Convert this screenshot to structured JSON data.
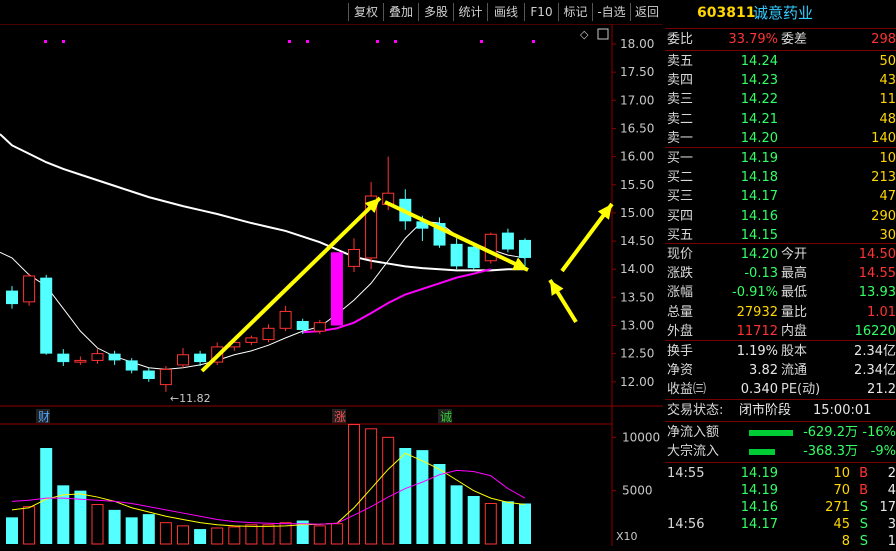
{
  "toolbar": {
    "buttons": [
      "复权",
      "叠加",
      "多股",
      "统计",
      "画线",
      "F10",
      "标记",
      "-自选",
      "返回"
    ]
  },
  "price_axis": {
    "ticks": [
      "18.00",
      "17.50",
      "17.00",
      "16.50",
      "16.00",
      "15.50",
      "15.00",
      "14.50",
      "14.00",
      "13.50",
      "13.00",
      "12.50",
      "12.00"
    ]
  },
  "volume_axis": {
    "ticks": [
      "10000",
      "5000"
    ],
    "unit": "X10"
  },
  "chart_labels": {
    "low_marker": "←11.82",
    "marker_cai": "财",
    "marker_zhang": "涨",
    "marker_cheng": "诚",
    "diamond": "◇"
  },
  "chart_data": {
    "type": "candlestick",
    "price_range": [
      11.7,
      18.1
    ],
    "candles": [
      {
        "o": 13.62,
        "c": 13.38,
        "h": 13.7,
        "l": 13.3
      },
      {
        "o": 13.42,
        "c": 13.88,
        "h": 13.92,
        "l": 13.35
      },
      {
        "o": 13.85,
        "c": 12.5,
        "h": 13.9,
        "l": 12.48
      },
      {
        "o": 12.5,
        "c": 12.35,
        "h": 12.58,
        "l": 12.28
      },
      {
        "o": 12.35,
        "c": 12.38,
        "h": 12.45,
        "l": 12.3
      },
      {
        "o": 12.38,
        "c": 12.5,
        "h": 12.58,
        "l": 12.32
      },
      {
        "o": 12.5,
        "c": 12.38,
        "h": 12.55,
        "l": 12.3
      },
      {
        "o": 12.38,
        "c": 12.2,
        "h": 12.42,
        "l": 12.15
      },
      {
        "o": 12.2,
        "c": 12.05,
        "h": 12.25,
        "l": 12.0
      },
      {
        "o": 11.95,
        "c": 12.22,
        "h": 12.28,
        "l": 11.82
      },
      {
        "o": 12.3,
        "c": 12.48,
        "h": 12.6,
        "l": 12.25
      },
      {
        "o": 12.5,
        "c": 12.35,
        "h": 12.55,
        "l": 12.28
      },
      {
        "o": 12.35,
        "c": 12.62,
        "h": 12.7,
        "l": 12.3
      },
      {
        "o": 12.62,
        "c": 12.7,
        "h": 12.78,
        "l": 12.55
      },
      {
        "o": 12.7,
        "c": 12.78,
        "h": 12.82,
        "l": 12.65
      },
      {
        "o": 12.75,
        "c": 12.95,
        "h": 13.02,
        "l": 12.7
      },
      {
        "o": 12.95,
        "c": 13.25,
        "h": 13.35,
        "l": 12.9
      },
      {
        "o": 13.08,
        "c": 12.92,
        "h": 13.12,
        "l": 12.85
      },
      {
        "o": 12.9,
        "c": 13.05,
        "h": 13.1,
        "l": 12.85
      },
      {
        "o": 13.0,
        "c": 14.3,
        "h": 14.3,
        "l": 13.0
      },
      {
        "o": 14.05,
        "c": 14.35,
        "h": 14.55,
        "l": 13.95
      },
      {
        "o": 14.2,
        "c": 15.3,
        "h": 15.55,
        "l": 14.0
      },
      {
        "o": 15.15,
        "c": 15.35,
        "h": 16.0,
        "l": 15.05
      },
      {
        "o": 15.25,
        "c": 14.85,
        "h": 15.42,
        "l": 14.7
      },
      {
        "o": 14.85,
        "c": 14.72,
        "h": 14.95,
        "l": 14.5
      },
      {
        "o": 14.82,
        "c": 14.42,
        "h": 14.92,
        "l": 14.38
      },
      {
        "o": 14.45,
        "c": 14.05,
        "h": 14.55,
        "l": 14.0
      },
      {
        "o": 14.4,
        "c": 14.02,
        "h": 14.45,
        "l": 13.98
      },
      {
        "o": 14.15,
        "c": 14.62,
        "h": 14.65,
        "l": 14.1
      },
      {
        "o": 14.65,
        "c": 14.35,
        "h": 14.72,
        "l": 14.3
      },
      {
        "o": 14.52,
        "c": 14.2,
        "h": 14.55,
        "l": 14.05
      }
    ],
    "ma_white_fast": [
      14.2,
      13.9,
      13.7,
      13.3,
      12.9,
      12.6,
      12.45,
      12.35,
      12.25,
      12.22,
      12.25,
      12.3,
      12.38,
      12.48,
      12.55,
      12.65,
      12.78,
      12.9,
      12.98,
      13.2,
      13.45,
      13.75,
      14.15,
      14.55,
      14.85,
      14.82,
      14.6,
      14.45,
      14.35,
      14.25,
      14.2
    ],
    "ma_white_slow": [
      16.2,
      16.05,
      15.9,
      15.78,
      15.68,
      15.58,
      15.48,
      15.38,
      15.28,
      15.2,
      15.12,
      15.05,
      14.98,
      14.9,
      14.82,
      14.75,
      14.68,
      14.58,
      14.48,
      14.35,
      14.22,
      14.15,
      14.1,
      14.05,
      14.02,
      14.0,
      13.98,
      13.98,
      13.98,
      14.0,
      14.0
    ],
    "ma_magenta_from": 17,
    "ma_magenta": [
      12.88,
      12.9,
      12.95,
      13.05,
      13.22,
      13.4,
      13.55,
      13.65,
      13.75,
      13.85,
      13.92,
      14.0
    ],
    "volume": [
      2500,
      3500,
      9000,
      5500,
      5000,
      3700,
      3200,
      2500,
      2800,
      2000,
      1700,
      1400,
      1500,
      1600,
      1800,
      1800,
      2000,
      2200,
      1700,
      1900,
      11200,
      10800,
      10000,
      9000,
      8800,
      7500,
      5500,
      4500,
      3800,
      4000,
      3800
    ],
    "volume_up": [
      false,
      true,
      false,
      false,
      false,
      true,
      false,
      false,
      false,
      true,
      true,
      false,
      true,
      true,
      true,
      true,
      true,
      false,
      true,
      true,
      true,
      true,
      true,
      false,
      false,
      false,
      false,
      false,
      true,
      false,
      false
    ],
    "vol_ma_yellow": [
      3200,
      3400,
      4200,
      4600,
      4700,
      4400,
      4000,
      3400,
      3000,
      2600,
      2300,
      2000,
      1800,
      1700,
      1650,
      1650,
      1700,
      1800,
      1850,
      1950,
      3400,
      5200,
      7000,
      8500,
      7800,
      7000,
      6000,
      5000,
      4300,
      3900,
      3700
    ],
    "vol_ma_magenta": [
      4000,
      4100,
      4300,
      4300,
      4200,
      4100,
      4000,
      3800,
      3500,
      3200,
      2900,
      2600,
      2300,
      2100,
      2000,
      1950,
      1900,
      1900,
      1850,
      1950,
      2700,
      3500,
      4400,
      5200,
      5800,
      6500,
      6900,
      6800,
      6400,
      5200,
      4300
    ],
    "vol_range": [
      0,
      12000
    ]
  },
  "panel": {
    "code": "603811",
    "name": "诚意药业",
    "weibi": {
      "label": "委比",
      "value": "33.79%",
      "label2": "委差",
      "value2": "298"
    },
    "sell": [
      {
        "label": "卖五",
        "price": "14.24",
        "vol": "50"
      },
      {
        "label": "卖四",
        "price": "14.23",
        "vol": "43"
      },
      {
        "label": "卖三",
        "price": "14.22",
        "vol": "11"
      },
      {
        "label": "卖二",
        "price": "14.21",
        "vol": "48"
      },
      {
        "label": "卖一",
        "price": "14.20",
        "vol": "140"
      }
    ],
    "buy": [
      {
        "label": "买一",
        "price": "14.19",
        "vol": "10"
      },
      {
        "label": "买二",
        "price": "14.18",
        "vol": "213"
      },
      {
        "label": "买三",
        "price": "14.17",
        "vol": "47"
      },
      {
        "label": "买四",
        "price": "14.16",
        "vol": "290"
      },
      {
        "label": "买五",
        "price": "14.15",
        "vol": "30"
      }
    ],
    "quote": [
      {
        "l1": "现价",
        "v1": "14.20",
        "l2": "今开",
        "v2": "14.50"
      },
      {
        "l1": "涨跌",
        "v1": "-0.13",
        "l2": "最高",
        "v2": "14.55"
      },
      {
        "l1": "涨幅",
        "v1": "-0.91%",
        "l2": "最低",
        "v2": "13.93"
      },
      {
        "l1": "总量",
        "v1": "27932",
        "l2": "量比",
        "v2": "1.01"
      },
      {
        "l1": "外盘",
        "v1": "11712",
        "l2": "内盘",
        "v2": "16220"
      }
    ],
    "fund": [
      {
        "l1": "换手",
        "v1": "1.19%",
        "l2": "股本",
        "v2": "2.34亿"
      },
      {
        "l1": "净资",
        "v1": "3.82",
        "l2": "流通",
        "v2": "2.34亿"
      },
      {
        "l1": "收益㈢",
        "v1": "0.340",
        "l2": "PE(动)",
        "v2": "21.2"
      }
    ],
    "status": {
      "label": "交易状态:",
      "value": "闭市阶段",
      "time": "15:00:01"
    },
    "flows": [
      {
        "label": "净流入额",
        "value": "-629.2万",
        "pct": "-16%"
      },
      {
        "label": "大宗流入",
        "value": "-368.3万",
        "pct": "-9%"
      }
    ],
    "ticks": [
      {
        "time": "14:55",
        "price": "14.19",
        "vol": "10",
        "side": "B",
        "n": "2"
      },
      {
        "time": "",
        "price": "14.19",
        "vol": "70",
        "side": "B",
        "n": "4"
      },
      {
        "time": "",
        "price": "14.16",
        "vol": "271",
        "side": "S",
        "n": "17"
      },
      {
        "time": "14:56",
        "price": "14.17",
        "vol": "45",
        "side": "S",
        "n": "3"
      },
      {
        "time": "",
        "price": "",
        "vol": "8",
        "side": "S",
        "n": "1"
      }
    ]
  },
  "colors": {
    "up": "#ff3232",
    "down": "#54ffff",
    "magenta": "#ff00ff",
    "yellow": "#ffff00",
    "white": "#ffffff",
    "grid": "#8b0000"
  }
}
